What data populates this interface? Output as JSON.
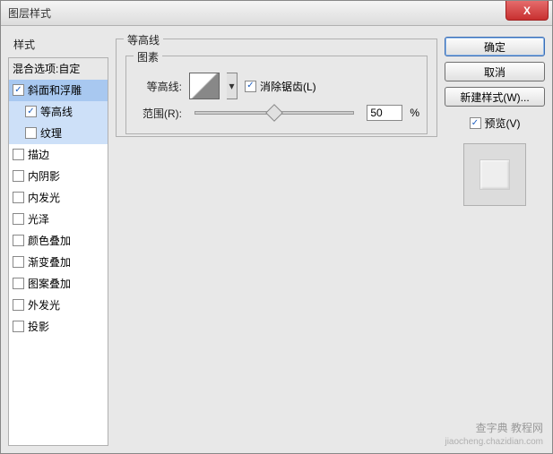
{
  "window": {
    "title": "图层样式"
  },
  "close": {
    "glyph": "X"
  },
  "left": {
    "header": "样式",
    "items": [
      {
        "label": "混合选项:自定",
        "checked": null,
        "header": true
      },
      {
        "label": "斜面和浮雕",
        "checked": true,
        "selected": true
      },
      {
        "label": "等高线",
        "checked": true,
        "sub": true,
        "selected2": true
      },
      {
        "label": "纹理",
        "checked": false,
        "sub": true,
        "selected2": true
      },
      {
        "label": "描边",
        "checked": false
      },
      {
        "label": "内阴影",
        "checked": false
      },
      {
        "label": "内发光",
        "checked": false
      },
      {
        "label": "光泽",
        "checked": false
      },
      {
        "label": "颜色叠加",
        "checked": false
      },
      {
        "label": "渐变叠加",
        "checked": false
      },
      {
        "label": "图案叠加",
        "checked": false
      },
      {
        "label": "外发光",
        "checked": false
      },
      {
        "label": "投影",
        "checked": false
      }
    ]
  },
  "mid": {
    "outer_group": "等高线",
    "inner_group": "图素",
    "contour_label": "等高线:",
    "antialias_label": "消除锯齿(L)",
    "antialias_checked": true,
    "range_label": "范围(R):",
    "range_value": "50",
    "range_unit": "%",
    "drop_glyph": "▾"
  },
  "right": {
    "ok": "确定",
    "cancel": "取消",
    "new_style": "新建样式(W)...",
    "preview_label": "预览(V)",
    "preview_checked": true
  },
  "watermark": {
    "line1": "查字典 教程网",
    "line2": "jiaocheng.chazidian.com"
  }
}
